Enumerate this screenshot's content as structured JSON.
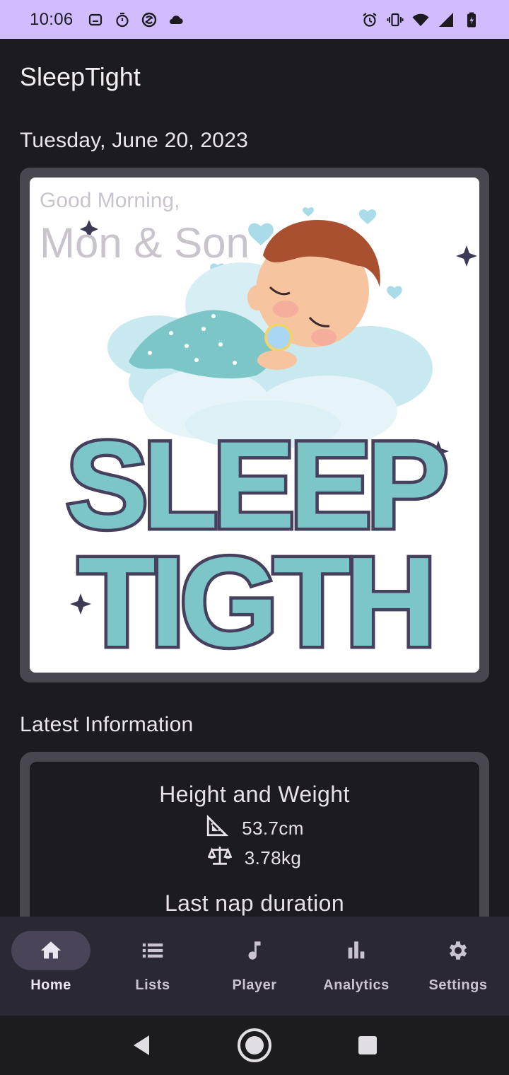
{
  "status_bar": {
    "time": "10:06",
    "left_icons": [
      "notification-card-icon",
      "stopwatch-icon",
      "sync-icon",
      "cloud-icon"
    ],
    "right_icons": [
      "alarm-icon",
      "vibrate-icon",
      "wifi-icon",
      "signal-icon",
      "battery-icon"
    ]
  },
  "header": {
    "app_title": "SleepTight",
    "date": "Tuesday, June 20, 2023"
  },
  "hero": {
    "greeting": "Good Morning,",
    "name": "Mon & Son",
    "logo_text_line1": "SLEEP",
    "logo_text_line2": "TIGTH"
  },
  "latest": {
    "section_title": "Latest Information",
    "height_weight_title": "Height and Weight",
    "height_value": "53.7cm",
    "weight_value": "3.78kg",
    "nap_title": "Last nap duration"
  },
  "bottom_nav": {
    "items": [
      {
        "label": "Home",
        "icon": "home-icon"
      },
      {
        "label": "Lists",
        "icon": "list-icon"
      },
      {
        "label": "Player",
        "icon": "music-note-icon"
      },
      {
        "label": "Analytics",
        "icon": "bar-chart-icon"
      },
      {
        "label": "Settings",
        "icon": "gear-icon"
      }
    ],
    "active_index": 0
  },
  "colors": {
    "status_bar_bg": "#d0bcff",
    "background": "#1c1b22",
    "card_frame": "#48464e",
    "logo_teal": "#7cc6c8",
    "logo_outline": "#46405e"
  }
}
